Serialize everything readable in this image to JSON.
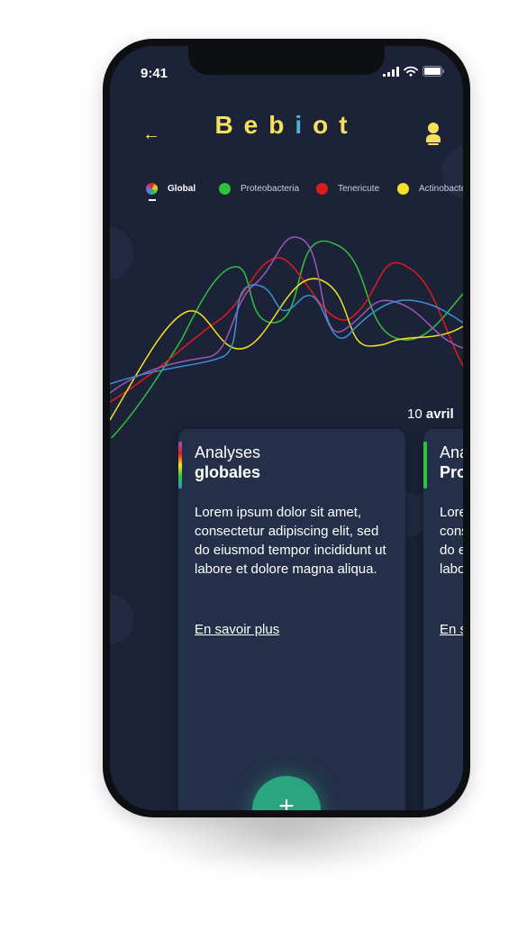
{
  "status": {
    "time": "9:41"
  },
  "header": {
    "logo": "Bebiot"
  },
  "legend": {
    "items": [
      {
        "label": "Global",
        "color": "gradient",
        "active": true
      },
      {
        "label": "Proteobacteria",
        "color": "#2fc23d"
      },
      {
        "label": "Tenericute",
        "color": "#e01b1b"
      },
      {
        "label": "Actinobacteria",
        "color": "#f2e125"
      }
    ]
  },
  "chart": {
    "series_colors": [
      "#2fc23d",
      "#e01b1b",
      "#f2e125",
      "#9b59b6",
      "#3b8fd8"
    ],
    "date_day": "10",
    "date_month": "avril"
  },
  "cards": [
    {
      "title_line1": "Analyses",
      "title_line2": "globales",
      "body": "Lorem ipsum dolor sit amet, consectetur adipiscing elit, sed do eiusmod tempor incididunt ut labore et dolore magna aliqua.",
      "link": "En savoir plus"
    },
    {
      "title_line1": "Analyses",
      "title_line2": "Proteobacteria",
      "body": "Lorem ipsum dolor sit amet, consectetur adipiscing elit, sed do eiusmod tempor incididunt ut labore et dolore magna aliqua.",
      "link": "En savoir plus"
    }
  ],
  "fab": {
    "label": "+"
  }
}
